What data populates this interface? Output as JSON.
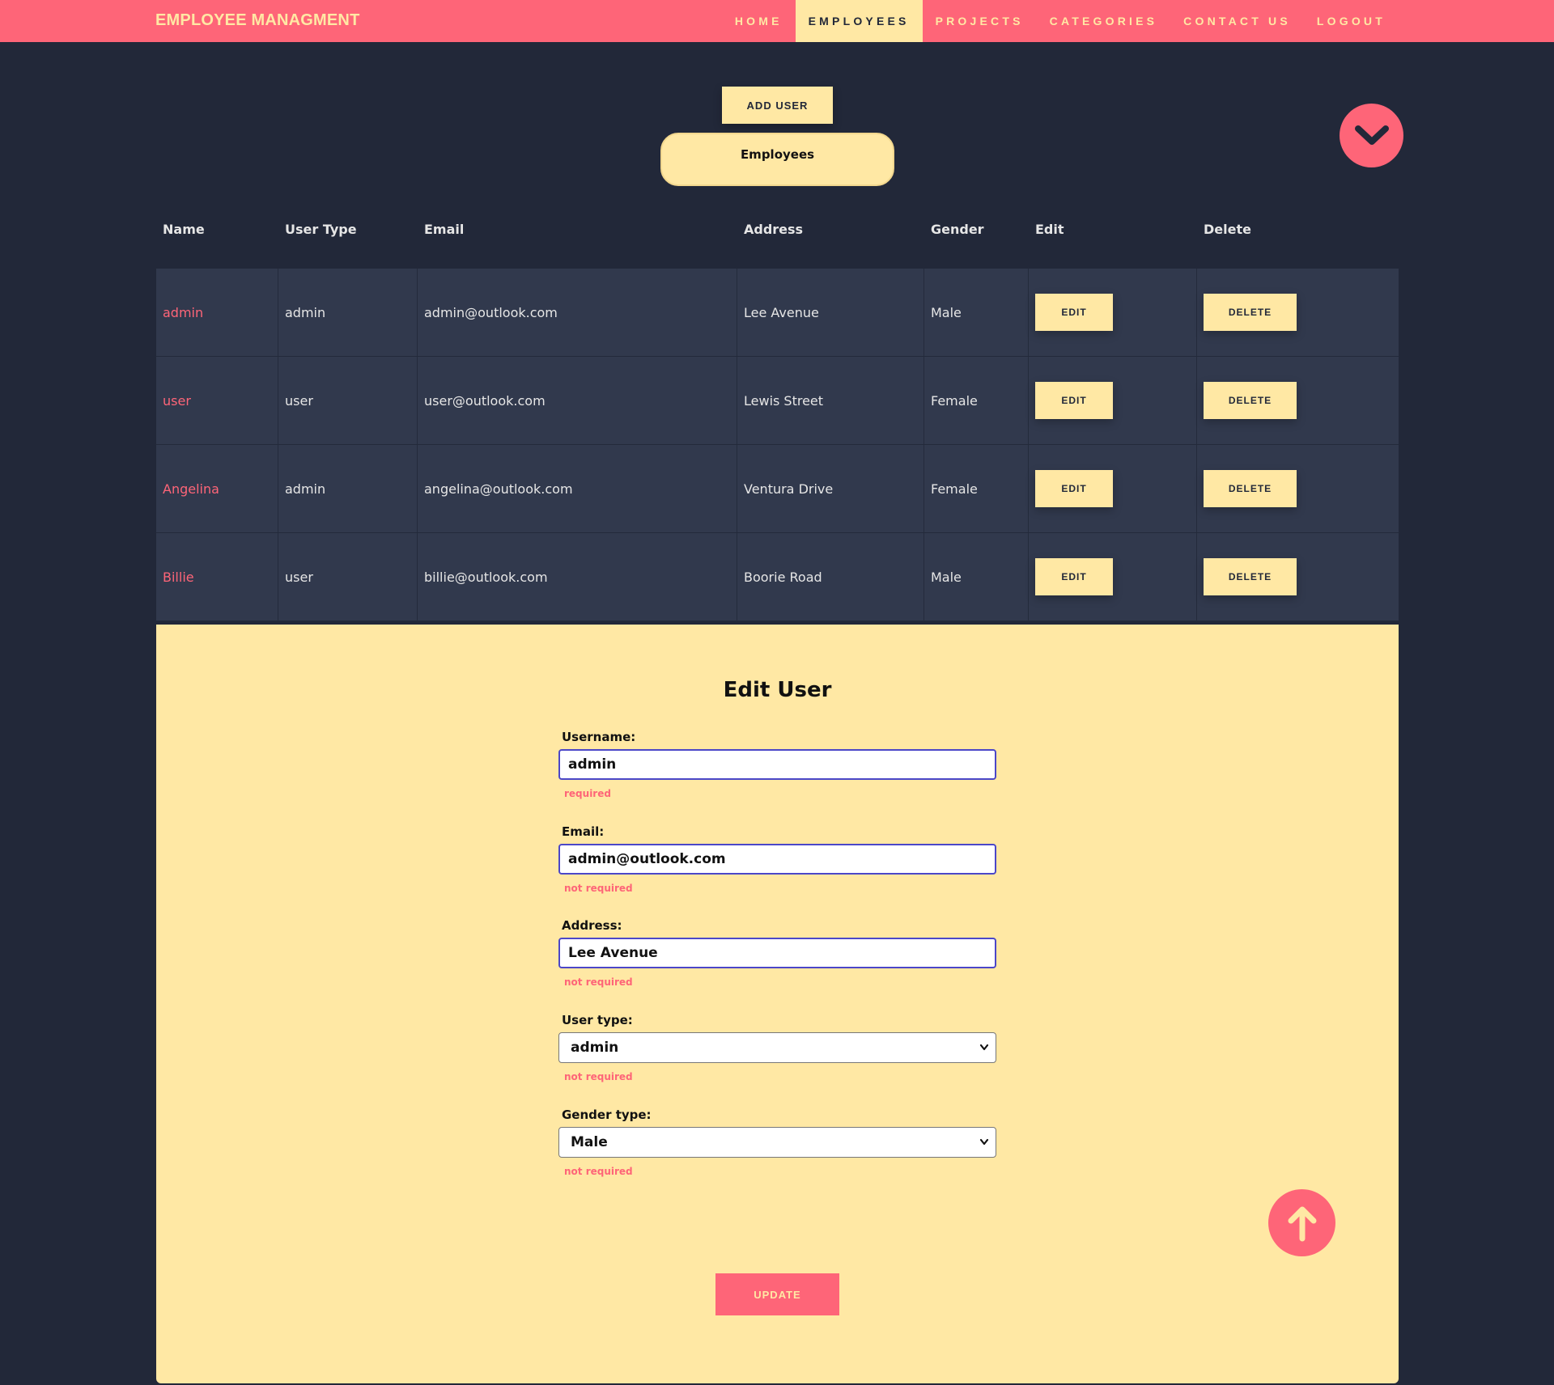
{
  "nav": {
    "brand": "EMPLOYEE MANAGMENT",
    "links": [
      "HOME",
      "EMPLOYEES",
      "PROJECTS",
      "CATEGORIES",
      "CONTACT US",
      "LOGOUT"
    ],
    "active": "EMPLOYEES"
  },
  "actions": {
    "add_user_label": "ADD USER",
    "section_label": "Employees",
    "scroll_down_icon": "chevron-down-icon",
    "scroll_up_icon": "arrow-up-icon"
  },
  "table": {
    "headers": [
      "Name",
      "User Type",
      "Email",
      "Address",
      "Gender",
      "Edit",
      "Delete"
    ],
    "rows": [
      {
        "name": "admin",
        "user_type": "admin",
        "email": "admin@outlook.com",
        "address": "Lee Avenue",
        "gender": "Male"
      },
      {
        "name": "user",
        "user_type": "user",
        "email": "user@outlook.com",
        "address": "Lewis Street",
        "gender": "Female"
      },
      {
        "name": "Angelina",
        "user_type": "admin",
        "email": "angelina@outlook.com",
        "address": "Ventura Drive",
        "gender": "Female"
      },
      {
        "name": "Billie",
        "user_type": "user",
        "email": "billie@outlook.com",
        "address": "Boorie Road",
        "gender": "Male"
      }
    ],
    "edit_label": "EDIT",
    "delete_label": "DELETE"
  },
  "edit_form": {
    "title": "Edit User",
    "username": {
      "label": "Username:",
      "value": "admin",
      "hint": "required"
    },
    "email": {
      "label": "Email:",
      "value": "admin@outlook.com",
      "hint": "not required"
    },
    "address": {
      "label": "Address:",
      "value": "Lee Avenue",
      "hint": "not required"
    },
    "user_type": {
      "label": "User type:",
      "value": "admin",
      "hint": "not required"
    },
    "gender": {
      "label": "Gender type:",
      "value": "Male",
      "hint": "not required"
    },
    "submit_label": "UPDATE"
  },
  "colors": {
    "background": "#222839",
    "accent": "#fe6578",
    "cream": "#ffe8a4",
    "row": "#31394d"
  }
}
